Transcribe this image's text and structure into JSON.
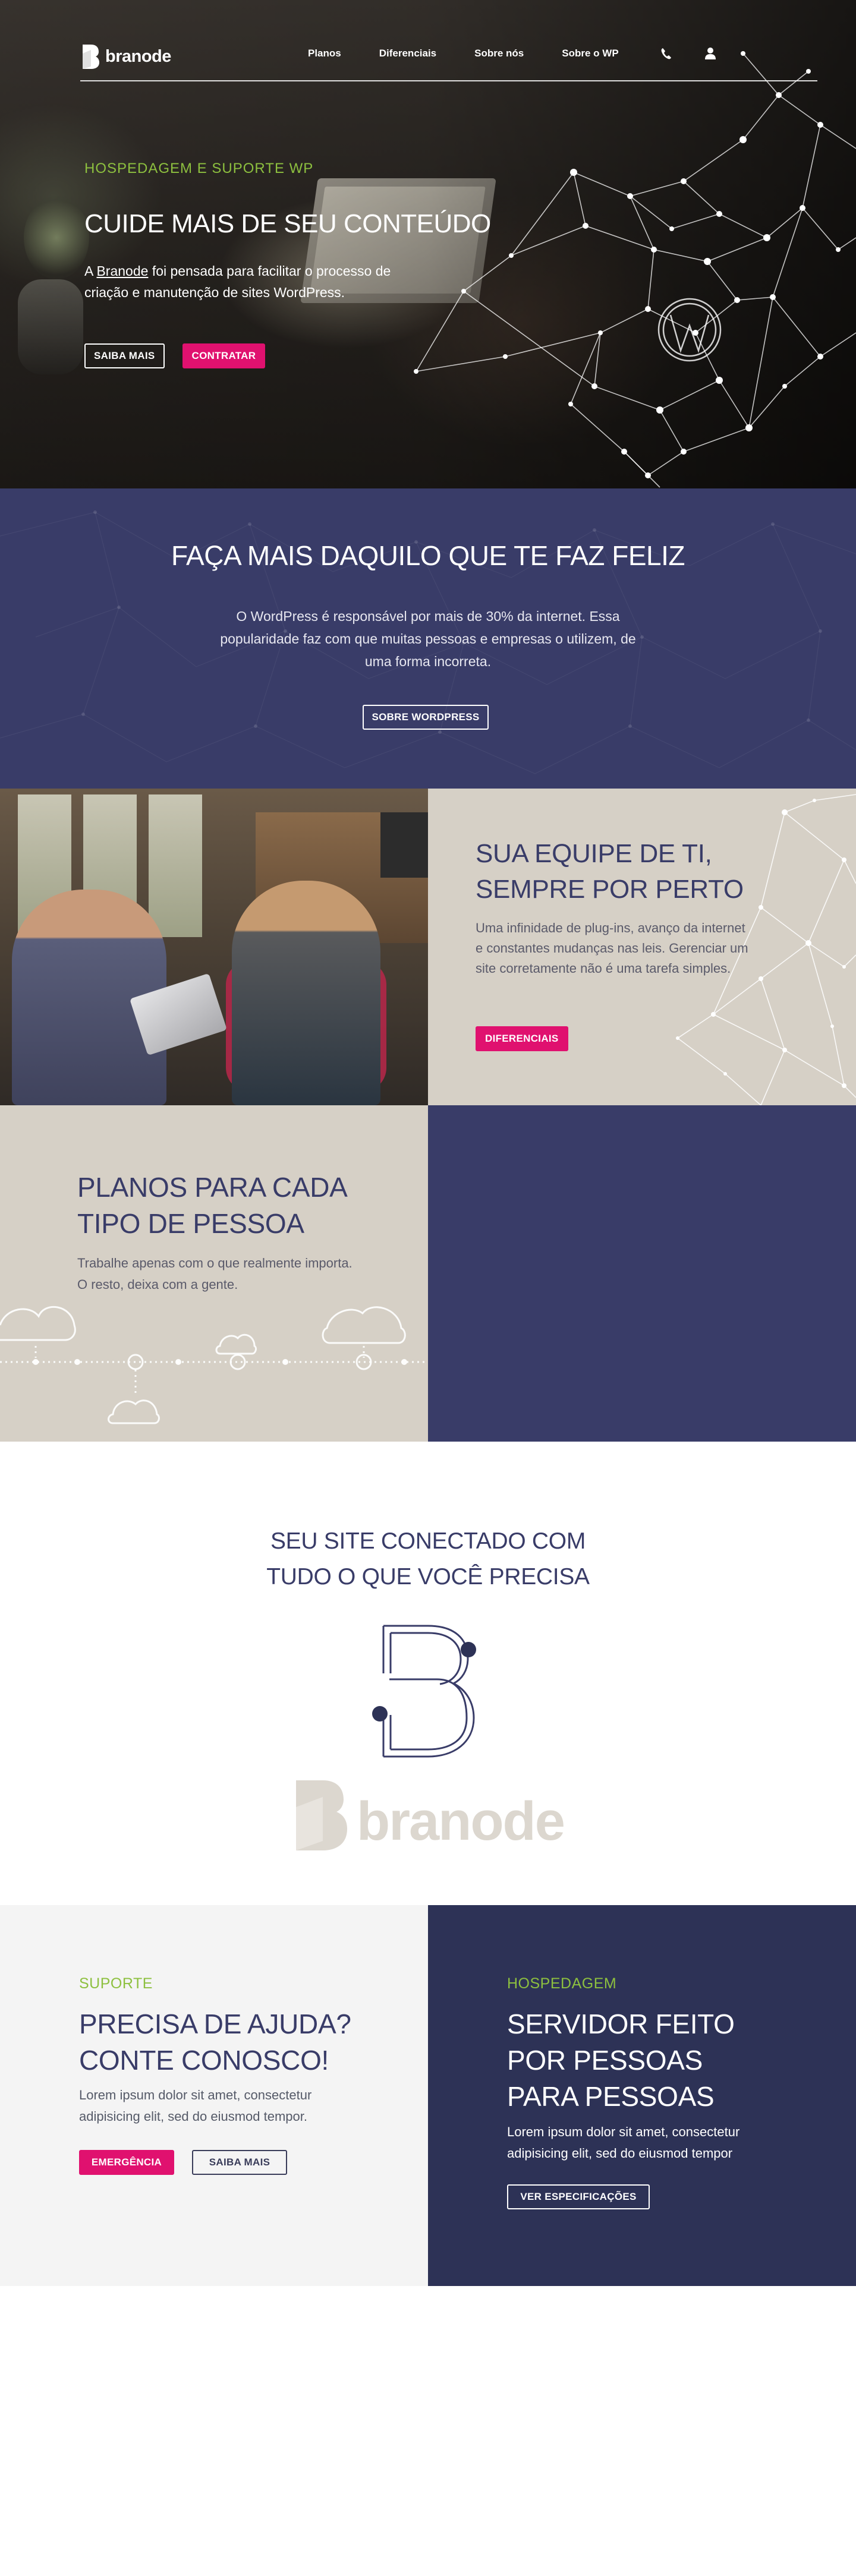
{
  "colors": {
    "accent_green": "#8dc03f",
    "accent_pink": "#e0116f",
    "navy": "#393c68",
    "navy_dark": "#2d3256",
    "beige": "#d6d0c6",
    "light_gray": "#f4f4f4"
  },
  "nav": {
    "logo_text": "branode",
    "items": [
      {
        "label": "Planos"
      },
      {
        "label": "Diferenciais"
      },
      {
        "label": "Sobre nós"
      },
      {
        "label": "Sobre o WP"
      }
    ],
    "icons": [
      "phone-icon",
      "user-icon"
    ]
  },
  "hero": {
    "eyebrow": "HOSPEDAGEM E SUPORTE WP",
    "title": "CUIDE MAIS DE SEU CONTEÚDO",
    "text_prefix": "A ",
    "text_link": "Branode",
    "text_suffix": " foi pensada para facilitar o processo de criação e manutenção de sites WordPress.",
    "btn_more": "SAIBA MAIS",
    "btn_hire": "CONTRATAR"
  },
  "feature": {
    "title": "FAÇA MAIS DAQUILO QUE TE FAZ FELIZ",
    "text": "O WordPress é responsável por mais de 30% da internet. Essa popularidade faz com que muitas pessoas e empresas o utilizem, de uma forma incorreta.",
    "button": "SOBRE WORDPRESS"
  },
  "team": {
    "title_line1": "SUA EQUIPE DE TI,",
    "title_line2": "SEMPRE POR PERTO",
    "text": "Uma infinidade de plug-ins, avanço da internet e constantes mudanças nas leis. Gerenciar um site corretamente não é uma tarefa simples.",
    "button": "DIFERENCIAIS"
  },
  "plans": {
    "title_line1": "PLANOS PARA CADA",
    "title_line2": "TIPO DE PESSOA",
    "text": "Trabalhe apenas com o que realmente importa. O resto, deixa com a gente."
  },
  "connected": {
    "title_line1": "SEU SITE CONECTADO COM",
    "title_line2": "TUDO O QUE VOCÊ PRECISA",
    "logo_text": "branode"
  },
  "support": {
    "eyebrow": "SUPORTE",
    "title_line1": "PRECISA DE AJUDA?",
    "title_line2": "CONTE CONOSCO!",
    "text": "Lorem ipsum dolor sit amet, consectetur adipisicing elit, sed do eiusmod tempor.",
    "btn_emergency": "EMERGÊNCIA",
    "btn_more": "SAIBA MAIS"
  },
  "hosting": {
    "eyebrow": "HOSPEDAGEM",
    "title_line1": "SERVIDOR FEITO",
    "title_line2": "POR PESSOAS",
    "title_line3": "PARA PESSOAS",
    "text": "Lorem ipsum dolor sit amet, consectetur adipisicing elit, sed do eiusmod tempor",
    "button": "VER ESPECIFICAÇÕES"
  }
}
